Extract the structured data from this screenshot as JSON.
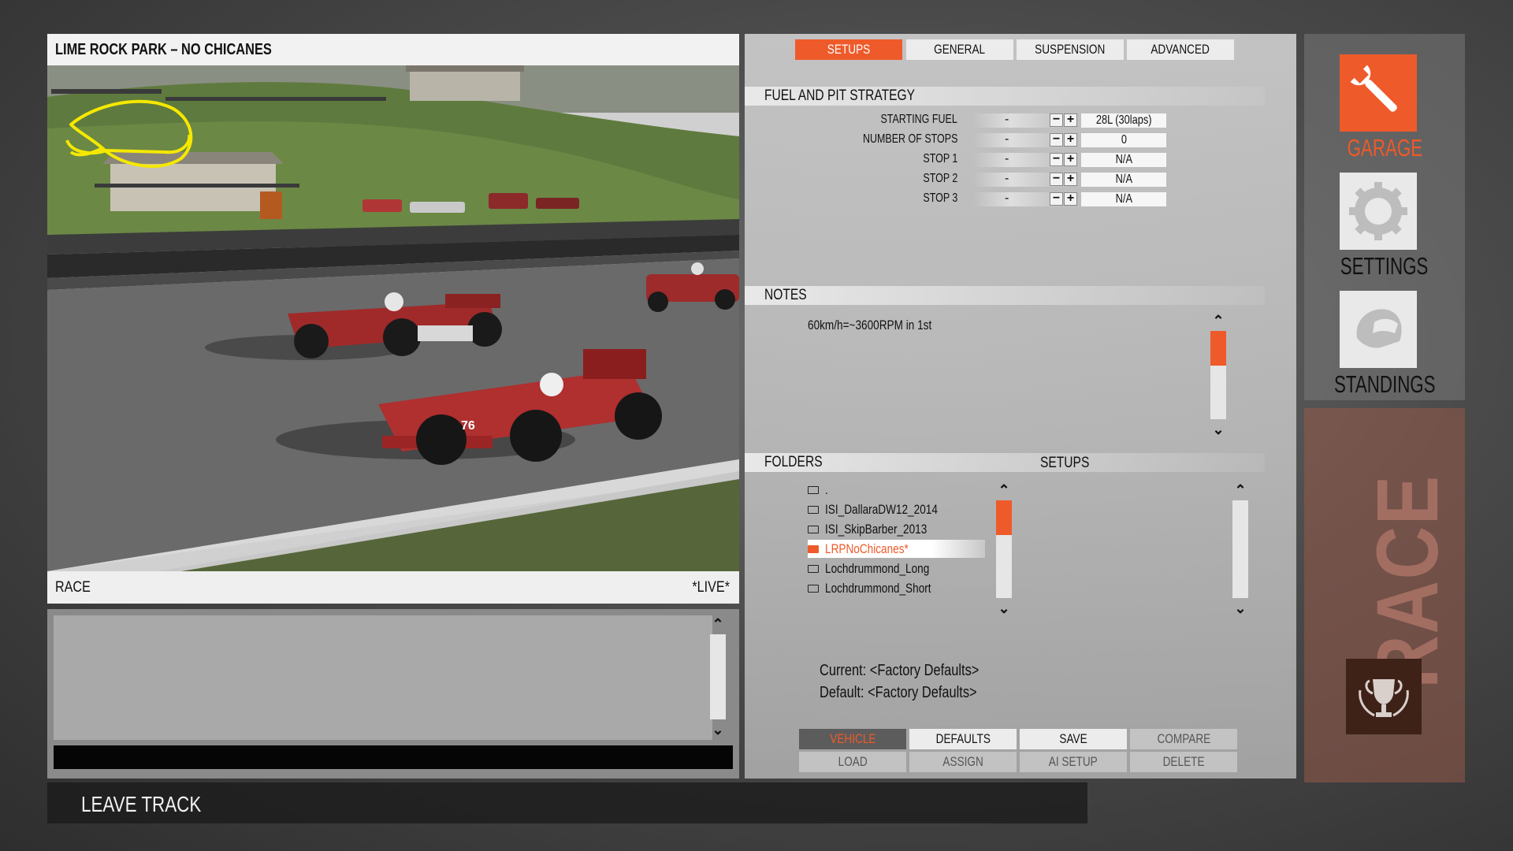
{
  "track": {
    "name": "LIME ROCK PARK – NO CHICANES"
  },
  "session": {
    "name": "RACE",
    "status": "*LIVE*"
  },
  "tabs": [
    "SETUPS",
    "GENERAL",
    "SUSPENSION",
    "ADVANCED"
  ],
  "fuel_strategy": {
    "heading": "FUEL AND PIT STRATEGY",
    "rows": [
      {
        "label": "STARTING FUEL",
        "dash": "-",
        "value": "28L (30laps)"
      },
      {
        "label": "NUMBER OF STOPS",
        "dash": "-",
        "value": "0"
      },
      {
        "label": "STOP 1",
        "dash": "-",
        "value": "N/A"
      },
      {
        "label": "STOP 2",
        "dash": "-",
        "value": "N/A"
      },
      {
        "label": "STOP 3",
        "dash": "-",
        "value": "N/A"
      }
    ]
  },
  "notes": {
    "heading": "NOTES",
    "text": "60km/h=~3600RPM in 1st"
  },
  "folders": {
    "heading": "FOLDERS",
    "items": [
      ".",
      "ISI_DallaraDW12_2014",
      "ISI_SkipBarber_2013",
      "LRPNoChicanes*",
      "Lochdrummond_Long",
      "Lochdrummond_Short"
    ],
    "selected": "LRPNoChicanes*"
  },
  "setups": {
    "heading": "SETUPS"
  },
  "setup_info": {
    "current": "Current: <Factory Defaults>",
    "default": "Default: <Factory Defaults>"
  },
  "bottom_buttons": {
    "row1": [
      "VEHICLE",
      "DEFAULTS",
      "SAVE",
      "COMPARE"
    ],
    "row2": [
      "LOAD",
      "ASSIGN",
      "AI SETUP",
      "DELETE"
    ]
  },
  "nav": {
    "garage": "GARAGE",
    "settings": "SETTINGS",
    "standings": "STANDINGS",
    "race": "RACE"
  },
  "footer": {
    "leave_track": "LEAVE TRACK"
  },
  "colors": {
    "accent": "#ee5a2a",
    "track_map": "#f5e800"
  },
  "icons": [
    "wrench-icon",
    "gear-icon",
    "helmet-icon",
    "trophy-icon",
    "folder-icon",
    "scroll-up-icon",
    "scroll-down-icon",
    "minus-icon",
    "plus-icon"
  ]
}
